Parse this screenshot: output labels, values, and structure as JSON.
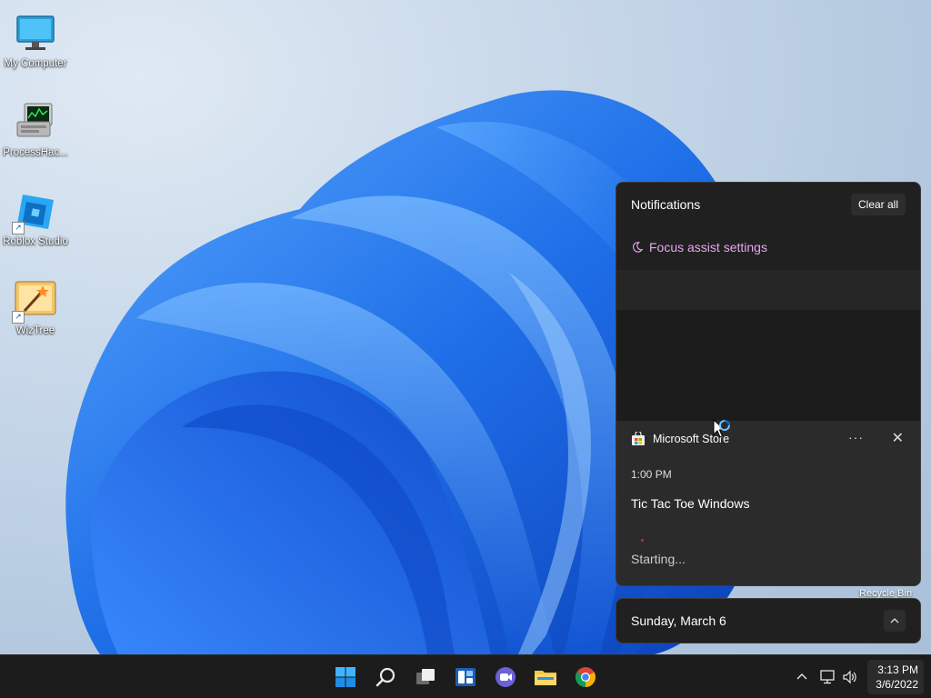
{
  "desktop": {
    "icons": [
      {
        "label": "My Computer",
        "icon": "monitor-icon"
      },
      {
        "label": "ProcessHac...",
        "icon": "process-hacker-icon"
      },
      {
        "label": "Roblox Studio",
        "icon": "roblox-studio-icon"
      },
      {
        "label": "WizTree",
        "icon": "wiztree-icon"
      }
    ],
    "recycle_bin_label": "Recycle Bin"
  },
  "notifications": {
    "title": "Notifications",
    "clear_all": "Clear all",
    "focus_assist": "Focus assist settings",
    "toast": {
      "app": "Microsoft Store",
      "more": "···",
      "close": "✕",
      "time": "1:00 PM",
      "title": "Tic Tac Toe Windows",
      "status": "Starting..."
    }
  },
  "calendar": {
    "date": "Sunday, March 6"
  },
  "taskbar": {
    "apps": [
      "start-icon",
      "search-icon",
      "task-view-icon",
      "widgets-icon",
      "chat-icon",
      "file-explorer-icon",
      "chrome-icon"
    ],
    "tray": [
      "chevron-up-icon",
      "network-icon",
      "volume-icon"
    ],
    "clock": {
      "time": "3:13 PM",
      "date": "3/6/2022"
    }
  },
  "colors": {
    "accent_blue": "#1a6fe0",
    "focus_link": "#e6a8ee",
    "panel_bg": "#202020",
    "taskbar_bg": "#1c1c1c"
  }
}
